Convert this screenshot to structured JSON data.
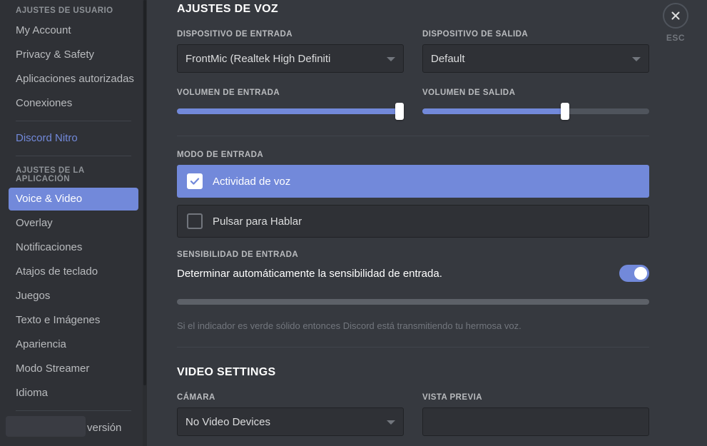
{
  "sidebar": {
    "user_settings_header": "AJUSTES DE USUARIO",
    "user_items": [
      {
        "label": "My Account"
      },
      {
        "label": "Privacy & Safety"
      },
      {
        "label": "Aplicaciones autorizadas"
      },
      {
        "label": "Conexiones"
      }
    ],
    "nitro_label": "Discord Nitro",
    "app_settings_header": "AJUSTES DE LA APLICACIÓN",
    "app_items": [
      {
        "label": "Voice & Video",
        "active": true
      },
      {
        "label": "Overlay",
        "active": false
      },
      {
        "label": "Notificaciones",
        "active": false
      },
      {
        "label": "Atajos de teclado",
        "active": false
      },
      {
        "label": "Juegos",
        "active": false
      },
      {
        "label": "Texto e Imágenes",
        "active": false
      },
      {
        "label": "Apariencia",
        "active": false
      },
      {
        "label": "Modo Streamer",
        "active": false
      },
      {
        "label": "Idioma",
        "active": false
      }
    ],
    "changelog_label": "Cambios en la versión"
  },
  "close": {
    "esc_label": "ESC"
  },
  "voice": {
    "title": "AJUSTES DE VOZ",
    "input_device_label": "DISPOSITIVO DE ENTRADA",
    "input_device_value": "FrontMic (Realtek High Definiti",
    "output_device_label": "DISPOSITIVO DE SALIDA",
    "output_device_value": "Default",
    "input_volume_label": "VOLUMEN DE ENTRADA",
    "input_volume_percent": 98,
    "output_volume_label": "VOLUMEN DE SALIDA",
    "output_volume_percent": 63,
    "input_mode_label": "MODO DE ENTRADA",
    "modes": [
      {
        "label": "Actividad de voz",
        "selected": true
      },
      {
        "label": "Pulsar para Hablar",
        "selected": false
      }
    ],
    "sensitivity_label": "SENSIBILIDAD DE ENTRADA",
    "auto_sensitivity_text": "Determinar automáticamente la sensibilidad de entrada.",
    "auto_sensitivity_on": true,
    "meter_percent": 0,
    "hint": "Si el indicador es verde sólido entonces Discord está transmitiendo tu hermosa voz."
  },
  "video": {
    "title": "VIDEO SETTINGS",
    "camera_label": "CÁMARA",
    "camera_value": "No Video Devices",
    "preview_label": "VISTA PREVIA"
  },
  "colors": {
    "accent": "#7289da",
    "sidebar_bg": "#2f3136",
    "main_bg": "#36393f",
    "text_muted": "#b9bbbe"
  }
}
